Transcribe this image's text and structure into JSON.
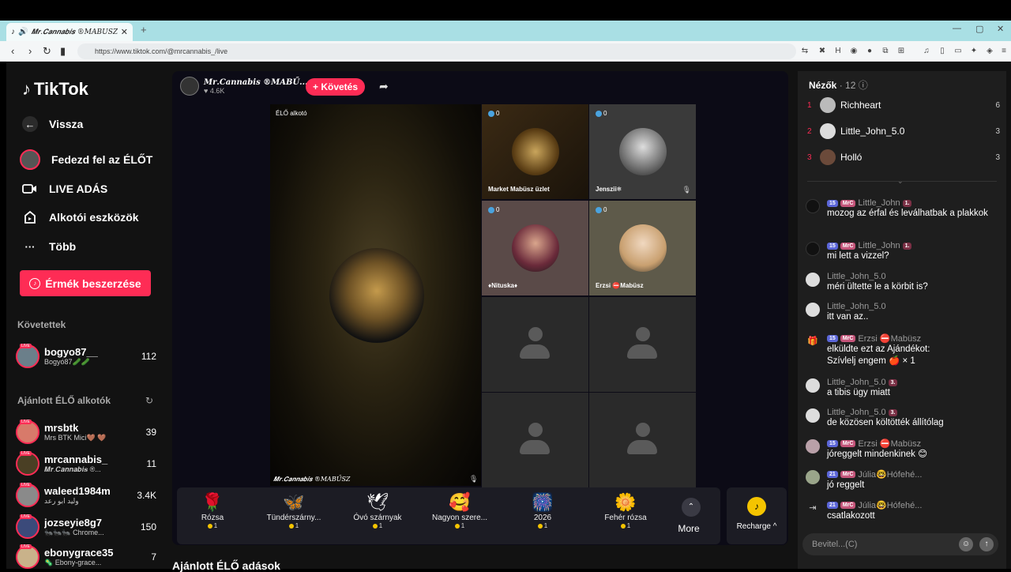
{
  "browser": {
    "tab_title": "𝑴𝒓.𝑪𝒂𝒏𝒏𝒂𝒃𝒊𝒔 ®MABŰSZ",
    "url": "https://www.tiktok.com/@mrcannabis_/live"
  },
  "sidebar": {
    "logo": "TikTok",
    "nav": [
      {
        "label": "Vissza",
        "icon": "back-arrow-icon"
      },
      {
        "label": "Fedezd fel az ÉLŐT",
        "icon": "avatar-icon"
      },
      {
        "label": "LIVE ADÁS",
        "icon": "camera-icon"
      },
      {
        "label": "Alkotói eszközök",
        "icon": "creator-tools-icon"
      },
      {
        "label": "Több",
        "icon": "more-dots-icon"
      }
    ],
    "coin_button": "Érmék beszerzése",
    "following_header": "Követettek",
    "following": [
      {
        "name": "bogyo87__",
        "sub": "Bogyó87🥒🥒",
        "count": "112"
      }
    ],
    "recommended_header": "Ajánlott ÉLŐ alkotók",
    "recommended": [
      {
        "name": "mrsbtk",
        "sub": "Mrs BTK Mici🤎 🤎",
        "count": "39"
      },
      {
        "name": "mrcannabis_",
        "sub": "𝑴𝒓.𝑪𝒂𝒏𝒏𝒂𝒃𝒊𝒔 ®...",
        "count": "11"
      },
      {
        "name": "waleed1984m",
        "sub": "وليد ابو رعد",
        "count": "3.4K"
      },
      {
        "name": "jozseyie8g7",
        "sub": "🐜🐜🐜 Chrome...",
        "count": "150"
      },
      {
        "name": "ebonygrace35",
        "sub": "🦠 Ebony-grace...",
        "count": "7"
      }
    ]
  },
  "stream": {
    "host_name": "𝑴𝒓.𝑪𝒂𝒏𝒏𝒂𝒃𝒊𝒔 ®MABŰ...",
    "host_likes": "♥ 4.6K",
    "follow_label": "+ Követés",
    "stage_label": "ÉLŐ alkotó",
    "stage_name": "𝑴𝒓.𝑪𝒂𝒏𝒏𝒂𝒃𝒊𝒔 ®MABŰSZ",
    "guests": [
      {
        "name": "Market Mabüsz üzlet",
        "score": "0"
      },
      {
        "name": "Jenszii❄",
        "score": "0"
      },
      {
        "name": "♦Nituska♦",
        "score": "0"
      },
      {
        "name": "Erzsi ⛔Mabüsz",
        "score": "0"
      }
    ]
  },
  "gifts": [
    {
      "name": "Rózsa",
      "price": "1",
      "icon": "🌹"
    },
    {
      "name": "Tündérszárny...",
      "price": "1",
      "icon": "🦋"
    },
    {
      "name": "Óvó szárnyak",
      "price": "1",
      "icon": "🕊"
    },
    {
      "name": "Nagyon szere...",
      "price": "1",
      "icon": "🥰"
    },
    {
      "name": "2026",
      "price": "1",
      "icon": "🎆"
    },
    {
      "name": "Fehér rózsa",
      "price": "1",
      "icon": "🌼"
    }
  ],
  "more_label": "More",
  "recharge_label": "Recharge ^",
  "recommend_heading": "Ajánlott ÉLŐ adások",
  "viewers": {
    "title": "Nézők",
    "count": "· 12",
    "list": [
      {
        "rank": "1",
        "name": "Richheart",
        "score": "6"
      },
      {
        "rank": "2",
        "name": "Little_John_5.0",
        "score": "3"
      },
      {
        "rank": "3",
        "name": "Holló",
        "score": "3"
      }
    ]
  },
  "chat": [
    {
      "badges": [
        "15",
        "MrC"
      ],
      "user": "Little_John",
      "tag": "1.",
      "text": "mozog az érfal és leválhatbak a plakkok"
    },
    {
      "badges": [
        "15",
        "MrC"
      ],
      "user": "Little_John",
      "tag": "1.",
      "text": "mi lett a vizzel?"
    },
    {
      "badges": [],
      "user": "Little_John_5.0",
      "tag": "",
      "text": "méri ültette le a körbit is?"
    },
    {
      "badges": [],
      "user": "Little_John_5.0",
      "tag": "",
      "text": "itt van az.."
    },
    {
      "badges": [
        "15",
        "MrC"
      ],
      "user": "Erzsi ⛔Mabüsz",
      "tag": "",
      "text": "elküldte ezt az Ajándékot: Szívlelj engem 🍎 × 1"
    },
    {
      "badges": [],
      "user": "Little_John_5.0",
      "tag": "3.",
      "text": "a tibis ügy miatt"
    },
    {
      "badges": [],
      "user": "Little_John_5.0",
      "tag": "3.",
      "text": "de közösen költötték állítólag"
    },
    {
      "badges": [
        "15",
        "MrC"
      ],
      "user": "Erzsi ⛔Mabüsz",
      "tag": "",
      "text": "jóreggelt mindenkinek 😊"
    },
    {
      "badges": [
        "21",
        "MrC"
      ],
      "user": "Júlia🤓Hófehé...",
      "tag": "",
      "text": "jó reggelt"
    },
    {
      "badges": [
        "21",
        "MrC"
      ],
      "user": "Júlia🤓Hófehé...",
      "tag": "",
      "text": "csatlakozott"
    }
  ],
  "input_placeholder": "Bevitel...(C)"
}
